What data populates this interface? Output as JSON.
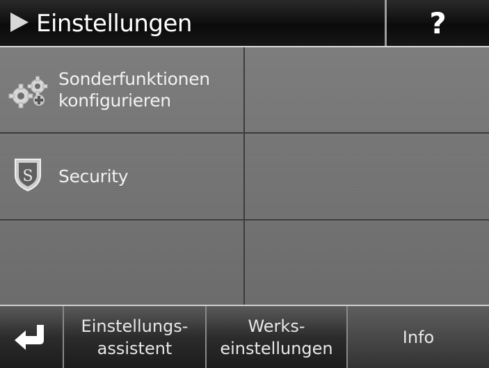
{
  "header": {
    "title": "Einstellungen",
    "help_label": "?"
  },
  "main": {
    "items": [
      {
        "label_line1": "Sonderfunktionen",
        "label_line2": "konfigurieren",
        "icon": "gears-icon"
      },
      {
        "label": "Security",
        "icon": "shield-icon"
      }
    ]
  },
  "footer": {
    "back_icon": "back-arrow-icon",
    "assistant_line1": "Einstellungs-",
    "assistant_line2": "assistent",
    "factory_line1": "Werks-",
    "factory_line2": "einstellungen",
    "info_label": "Info"
  },
  "colors": {
    "header_bg": "#0b0b0b",
    "panel_bg": "#6f6f6f",
    "footer_bg": "#2c2c2c",
    "text": "#ffffff"
  }
}
